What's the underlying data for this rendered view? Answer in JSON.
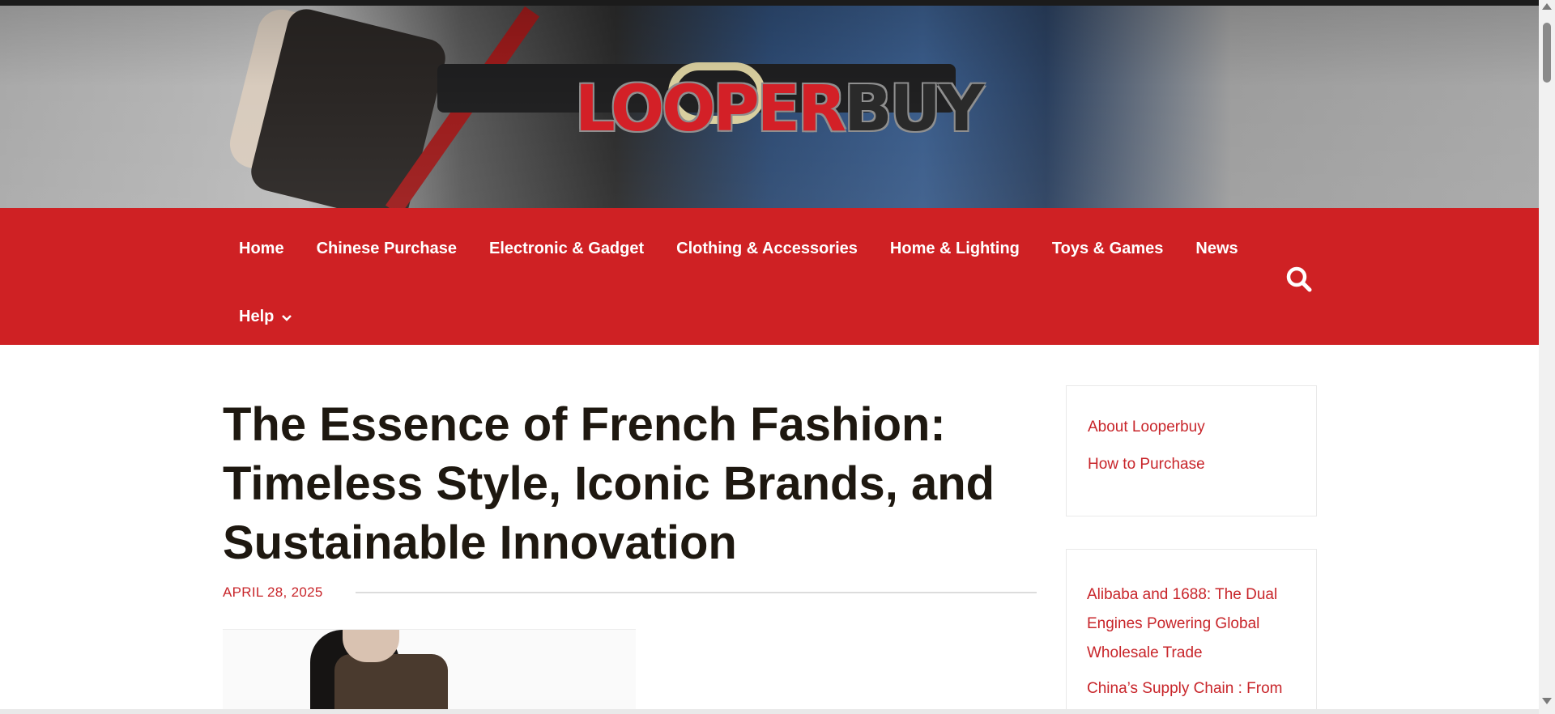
{
  "logo": {
    "part1": "LOOPER",
    "part2": "BUY",
    "colors": {
      "red": "#d32027",
      "dark": "#2a2a2a"
    }
  },
  "nav": {
    "background": "#cf2124",
    "items": [
      {
        "label": "Home"
      },
      {
        "label": "Chinese Purchase"
      },
      {
        "label": "Electronic & Gadget"
      },
      {
        "label": "Clothing & Accessories"
      },
      {
        "label": "Home & Lighting"
      },
      {
        "label": "Toys & Games"
      },
      {
        "label": "News"
      },
      {
        "label": "Help",
        "icon": "chevron-down-icon"
      }
    ],
    "search_icon": "search-icon"
  },
  "article": {
    "title": "The Essence of French Fashion: Timeless Style, Iconic Brands, and Sustainable Innovation",
    "date": "APRIL 28, 2025"
  },
  "sidebar": {
    "pages": [
      {
        "label": "About Looperbuy"
      },
      {
        "label": "How to Purchase"
      }
    ],
    "recent_posts": [
      {
        "label": "Alibaba and 1688: The Dual Engines Powering Global Wholesale Trade"
      },
      {
        "label": "China’s Supply Chain : From"
      }
    ]
  },
  "theme": {
    "accent": "#c8252a",
    "title_color": "#1e1810"
  }
}
